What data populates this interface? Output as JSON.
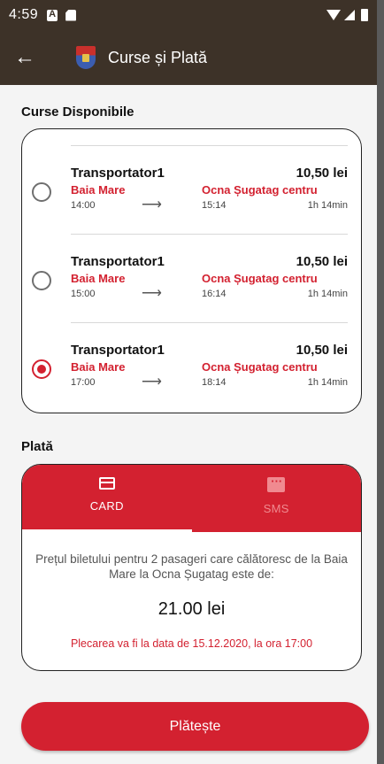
{
  "status_bar": {
    "time": "4:59"
  },
  "app_bar": {
    "title": "Curse și Plată",
    "back_icon": "arrow-left-icon"
  },
  "routes_section": {
    "title": "Curse Disponibile"
  },
  "routes": [
    {
      "carrier": "Transportator1",
      "price": "10,50 lei",
      "from": "Baia Mare",
      "to": "Ocna Șugatag centru",
      "departure": "14:00",
      "arrival": "15:14",
      "duration": "1h 14min",
      "selected": false
    },
    {
      "carrier": "Transportator1",
      "price": "10,50 lei",
      "from": "Baia Mare",
      "to": "Ocna Șugatag centru",
      "departure": "15:00",
      "arrival": "16:14",
      "duration": "1h 14min",
      "selected": false
    },
    {
      "carrier": "Transportator1",
      "price": "10,50 lei",
      "from": "Baia Mare",
      "to": "Ocna Șugatag centru",
      "departure": "17:00",
      "arrival": "18:14",
      "duration": "1h 14min",
      "selected": true
    }
  ],
  "payment": {
    "title": "Plată",
    "tabs": [
      {
        "label": "CARD",
        "active": true
      },
      {
        "label": "SMS",
        "active": false
      }
    ],
    "description": "Prețul biletului pentru 2 pasageri care călătoresc de la Baia Mare la Ocna Șugatag este de:",
    "amount": "21.00 lei",
    "note": "Plecarea va fi la data de 15.12.2020, la ora 17:00"
  },
  "pay_button": {
    "label": "Plătește"
  },
  "colors": {
    "accent": "#d32130",
    "app_bar": "#3d3228"
  }
}
